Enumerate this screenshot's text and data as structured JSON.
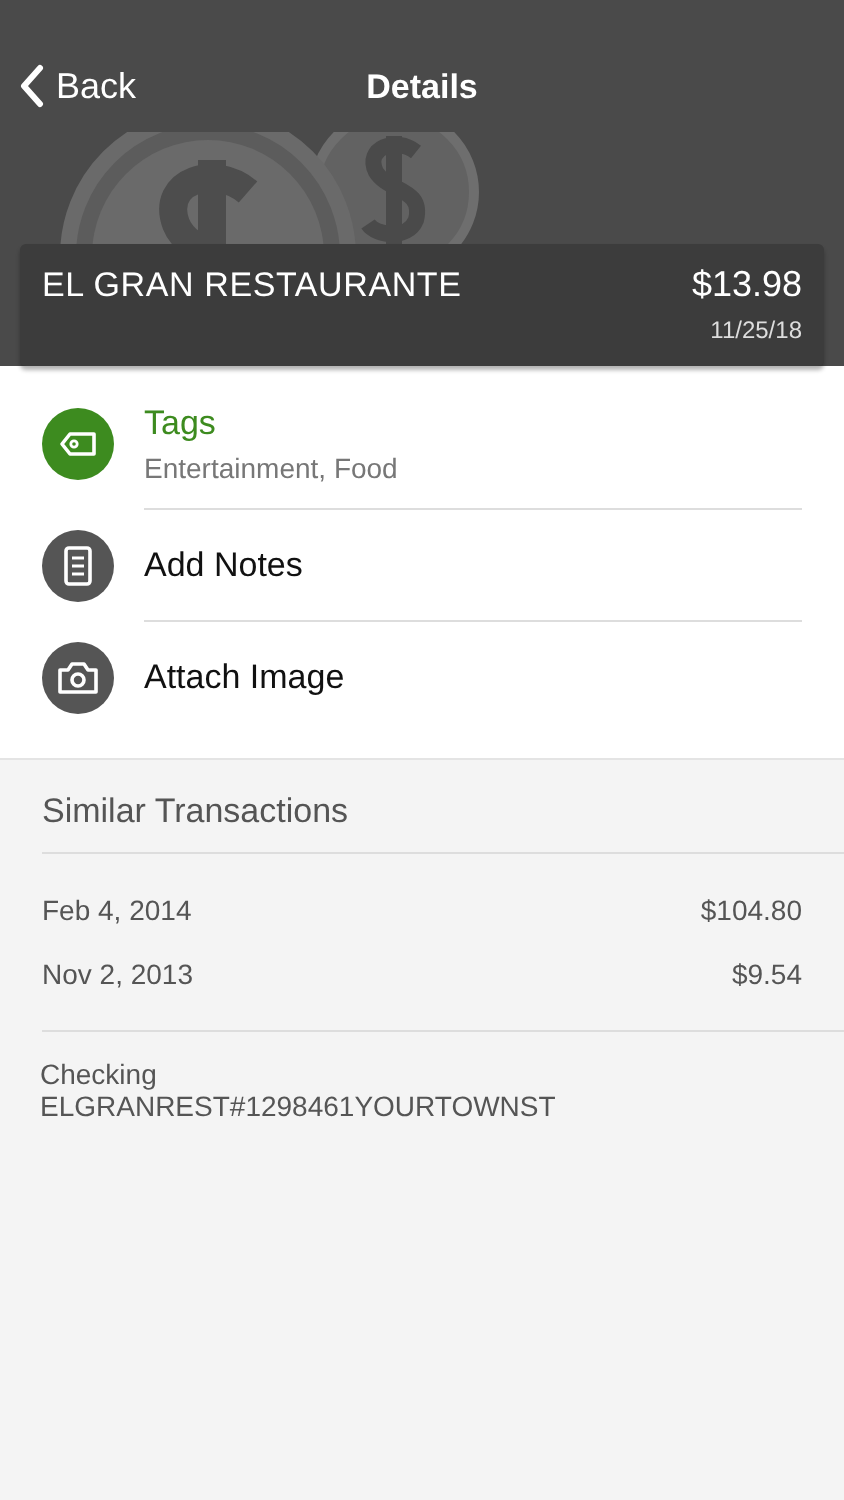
{
  "nav": {
    "back": "Back",
    "title": "Details"
  },
  "header": {
    "merchant": "EL GRAN RESTAURANTE",
    "amount": "$13.98",
    "date": "11/25/18"
  },
  "actions": [
    {
      "kind": "tag",
      "title": "Tags",
      "subtitle": "Entertainment, Food",
      "color": "#3d8b1f"
    },
    {
      "kind": "notes",
      "title": "Add Notes",
      "color": "#555555"
    },
    {
      "kind": "camera",
      "title": "Attach Image",
      "color": "#555555"
    }
  ],
  "similar": {
    "title": "Similar Transactions",
    "rows": [
      {
        "date": "Feb 4, 2014",
        "amount": "$104.80"
      },
      {
        "date": "Nov 2, 2013",
        "amount": "$9.54"
      }
    ]
  },
  "account": {
    "name": "Checking",
    "description": "ELGRANREST#1298461YOURTOWNST"
  }
}
